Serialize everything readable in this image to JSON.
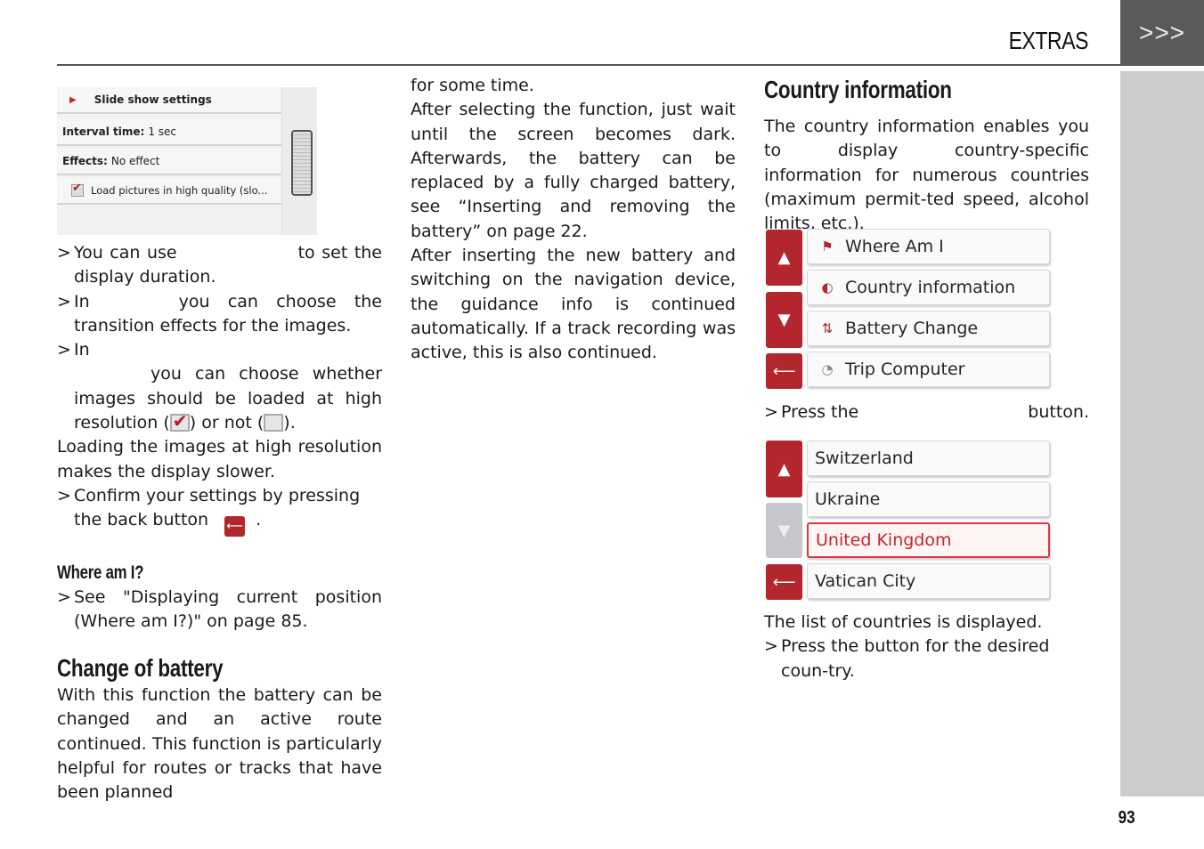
{
  "header": {
    "section_title": "EXTRAS",
    "nav_arrows": ">>>",
    "page_number": "93"
  },
  "slideshow_screenshot": {
    "title_icon": "play-icon",
    "title": "Slide show settings",
    "rows": [
      {
        "label": "Interval time:",
        "value": "1 sec"
      },
      {
        "label": "Effects:",
        "value": "No effect"
      },
      {
        "label": "",
        "value": "Load pictures in high quality (slo...",
        "checked": true
      }
    ]
  },
  "col1": {
    "bullet_interval_a": "You can use",
    "bullet_interval_b": "to set the display duration.",
    "bullet_effects_a": "In",
    "bullet_effects_b": "you can choose the transition effects for the images.",
    "bullet_quality_a": "In",
    "bullet_quality_b": "you can choose whether images should be loaded at high resolution (",
    "bullet_quality_c": ") or not (",
    "bullet_quality_d": ").",
    "loading_note": "Loading the images at high resolution makes the display slower.",
    "confirm_a": "Confirm your settings by pressing the back button",
    "confirm_b": ".",
    "where_heading": "Where am I?",
    "where_text": "See \"Displaying current position (Where am I?)\" on page 85.",
    "battery_heading": "Change of battery",
    "battery_text": "With this function the battery can be changed and an active route continued. This function is particularly helpful for routes or tracks that have been planned"
  },
  "col2": {
    "p1": "for some time.",
    "p2": "After selecting the function, just wait until the screen becomes dark. Afterwards, the battery can be replaced by a fully charged battery, see “Inserting and removing the battery” on page 22.",
    "p3": "After inserting the new battery and switching on the navigation device, the guidance info is continued automatically. If a track recording was active, this is also continued."
  },
  "col3": {
    "heading": "Country information",
    "intro": "The country information enables you to display country-specific information for numerous countries (maximum permit-ted speed, alcohol limits, etc.).",
    "press_a": "Press the",
    "press_b": "button.",
    "list_displayed": "The list of countries is displayed.",
    "press_country": "Press the button for the desired coun-try."
  },
  "extras_menu": {
    "items": [
      {
        "label": "Where Am I",
        "icon": "where-am-i-icon"
      },
      {
        "label": "Country information",
        "icon": "country-info-icon"
      },
      {
        "label": "Battery Change",
        "icon": "battery-change-icon"
      },
      {
        "label": "Trip Computer",
        "icon": "trip-computer-icon"
      }
    ],
    "up": "▲",
    "down": "▼",
    "back": "⟵"
  },
  "country_menu": {
    "items": [
      {
        "label": "Switzerland"
      },
      {
        "label": "Ukraine"
      },
      {
        "label": "United Kingdom",
        "selected": true
      },
      {
        "label": "Vatican City"
      }
    ],
    "up": "▲",
    "down": "▼",
    "back": "⟵"
  },
  "colors": {
    "accent_red": "#b3262d",
    "header_tab": "#5a5a5a",
    "side_bar": "#cccccc"
  }
}
